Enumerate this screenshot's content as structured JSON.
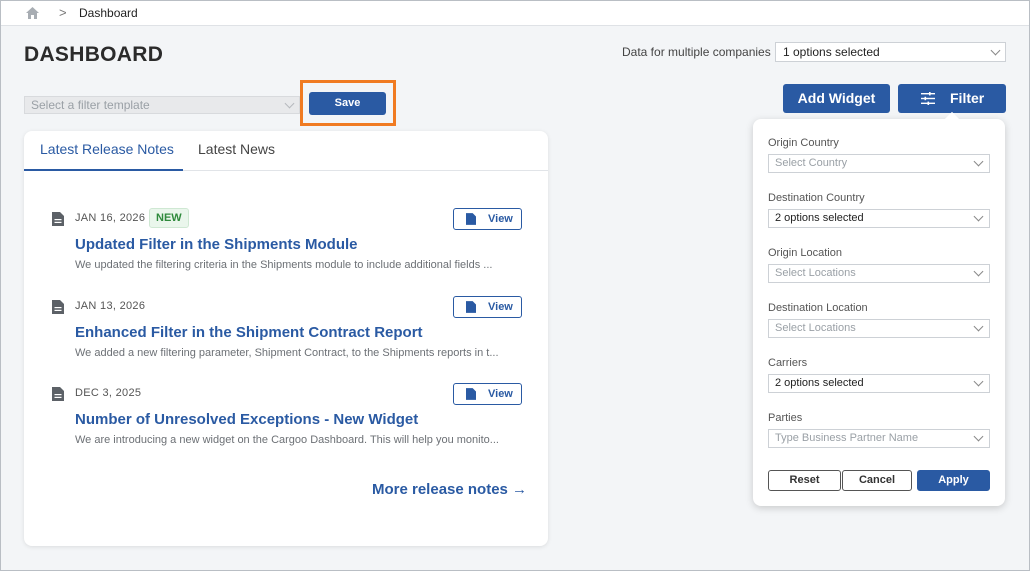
{
  "breadcrumb": {
    "current": "Dashboard",
    "separator": ">"
  },
  "page": {
    "title": "DASHBOARD"
  },
  "company": {
    "label": "Data for multiple companies",
    "value": "1 options selected"
  },
  "toolbar": {
    "template_placeholder": "Select a filter template",
    "save_label": "Save",
    "add_widget_label": "Add Widget",
    "filter_label": "Filter"
  },
  "card": {
    "tabs": [
      {
        "label": "Latest Release Notes",
        "active": true
      },
      {
        "label": "Latest News",
        "active": false
      }
    ],
    "notes": [
      {
        "date": "JAN 16, 2026",
        "badge": "NEW",
        "title": "Updated Filter in the Shipments Module",
        "description": "We updated the filtering criteria in the Shipments module to include additional fields ...",
        "view_label": "View"
      },
      {
        "date": "JAN 13, 2026",
        "title": "Enhanced Filter in the Shipment Contract Report",
        "description": "We added a new filtering parameter, Shipment Contract, to the Shipments reports in t...",
        "view_label": "View"
      },
      {
        "date": "DEC 3, 2025",
        "title": "Number of Unresolved Exceptions - New Widget",
        "description": "We are introducing a new widget on the Cargoo Dashboard. This will help you monito...",
        "view_label": "View"
      }
    ],
    "more_link": "More release notes →"
  },
  "filter_panel": {
    "fields": [
      {
        "label": "Origin Country",
        "placeholder": "Select Country",
        "value": ""
      },
      {
        "label": "Destination Country",
        "placeholder": "",
        "value": "2 options selected"
      },
      {
        "label": "Origin Location",
        "placeholder": "Select Locations",
        "value": ""
      },
      {
        "label": "Destination Location",
        "placeholder": "Select Locations",
        "value": ""
      },
      {
        "label": "Carriers",
        "placeholder": "",
        "value": "2 options selected"
      },
      {
        "label": "Parties",
        "placeholder": "Type Business Partner Name",
        "value": ""
      }
    ],
    "reset_label": "Reset",
    "cancel_label": "Cancel",
    "apply_label": "Apply"
  },
  "colors": {
    "primary": "#2a5aa3",
    "highlight": "#f07b22",
    "badge_green": "#2f8a3c"
  }
}
